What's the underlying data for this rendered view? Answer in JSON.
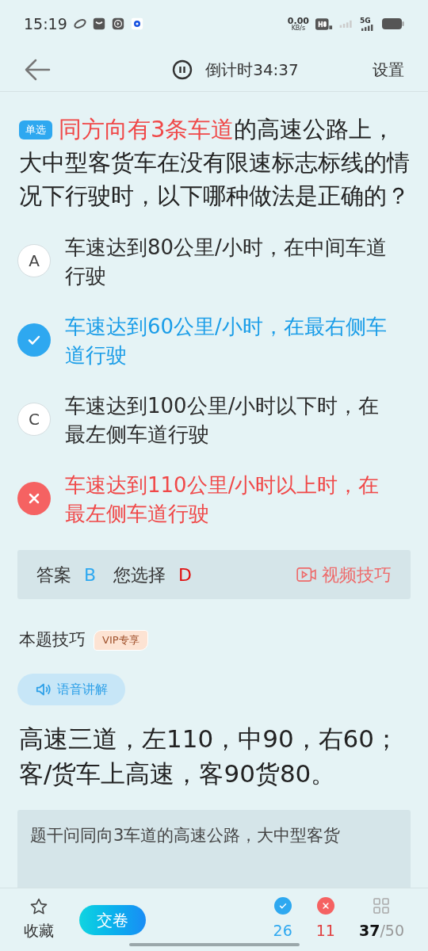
{
  "status_bar": {
    "time": "15:19",
    "speed_value": "0.00",
    "speed_unit": "KB/s",
    "network": "5G"
  },
  "header": {
    "timer": "倒计时34:37",
    "settings": "设置"
  },
  "question": {
    "type": "单选",
    "highlight": "同方向有3条车道",
    "text": "的高速公路上，大中型客货车在没有限速标志标线的情况下行驶时，以下哪种做法是正确的？"
  },
  "options": [
    {
      "kind": "normal",
      "letter": "A",
      "text": "车速达到80公里/小时，在中间车道行驶"
    },
    {
      "kind": "correct",
      "text": "车速达到60公里/小时，在最右侧车道行驶"
    },
    {
      "kind": "normal",
      "letter": "C",
      "text": "车速达到100公里/小时以下时，在最左侧车道行驶"
    },
    {
      "kind": "wrong",
      "text": "车速达到110公里/小时以上时，在最左侧车道行驶"
    }
  ],
  "result": {
    "answer_label": "答案",
    "answer": "B",
    "choice_label": "您选择",
    "choice": "D",
    "video_link": "视频技巧"
  },
  "tips": {
    "title": "本题技巧",
    "badge": "VIP专享",
    "audio_button": "语音讲解",
    "mnemonic": "高速三道，左110，中90，右60；客/货车上高速，客90货80。",
    "explanation": "题干问同向3车道的高速公路，大中型客货"
  },
  "bottom_bar": {
    "favorite": "收藏",
    "submit": "交卷",
    "correct_count": "26",
    "wrong_count": "11",
    "current": "37",
    "total": "/50"
  }
}
